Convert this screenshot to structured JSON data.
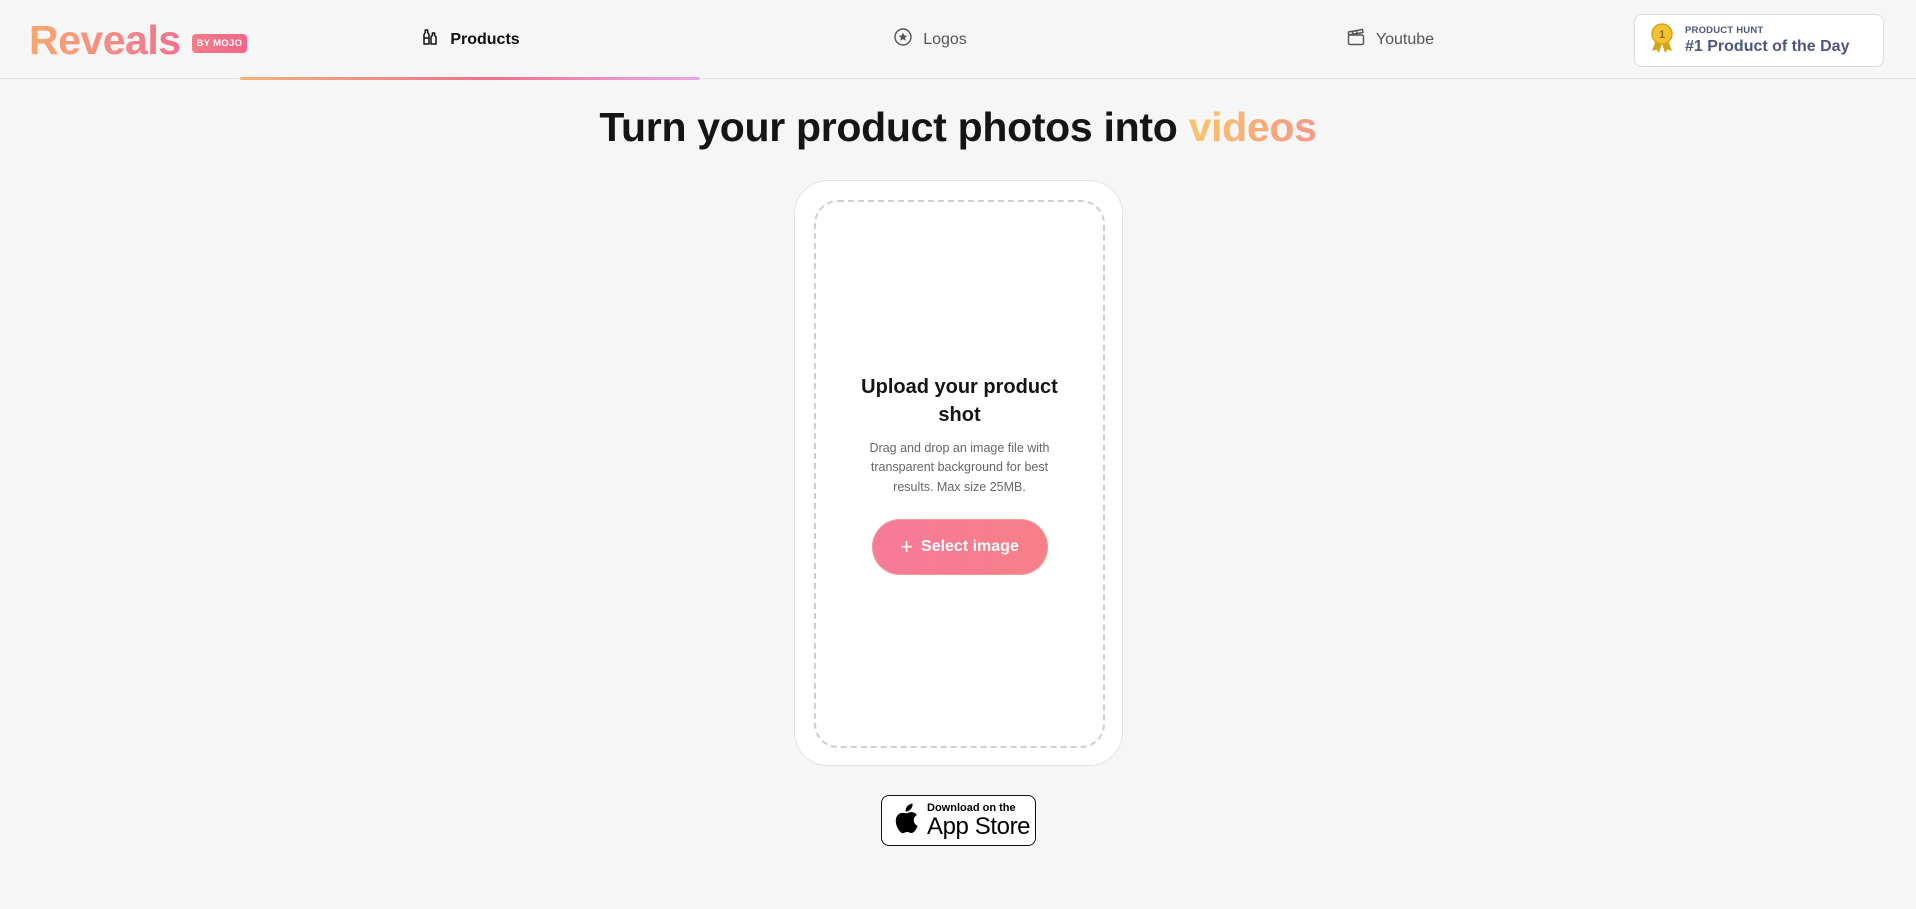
{
  "brand": {
    "name": "Reveals",
    "badge": "BY MOJO"
  },
  "tabs": [
    {
      "label": "Products",
      "icon": "bottles-icon",
      "active": true
    },
    {
      "label": "Logos",
      "icon": "star-circle-icon",
      "active": false
    },
    {
      "label": "Youtube",
      "icon": "clapperboard-icon",
      "active": false
    }
  ],
  "product_hunt": {
    "top": "PRODUCT HUNT",
    "bottom": "#1 Product of the Day",
    "medal_number": "1"
  },
  "hero": {
    "headline_main": "Turn your product photos into ",
    "headline_accent": "videos"
  },
  "upload": {
    "title": "Upload your product shot",
    "description": "Drag and drop an image file with transparent background for best results. Max size 25MB.",
    "button_label": "Select image"
  },
  "app_store": {
    "small": "Download on the",
    "big": "App Store"
  },
  "colors": {
    "accent_pink": "#f4708f",
    "accent_orange": "#f8a86b",
    "ph_text": "#4b587c"
  }
}
